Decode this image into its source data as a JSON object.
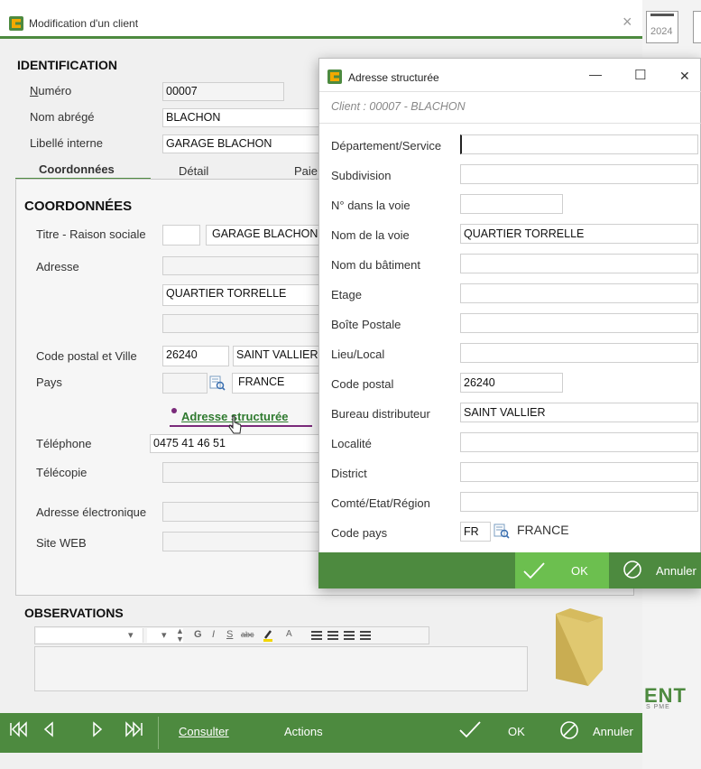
{
  "main": {
    "title": "Modification d'un client",
    "close": "×",
    "year": "2024",
    "identification": {
      "heading": "IDENTIFICATION",
      "numero_label": "Numéro",
      "numero_value": "00007",
      "nom_label": "Nom abrégé",
      "nom_value": "BLACHON",
      "libelle_label": "Libellé interne",
      "libelle_value": "GARAGE BLACHON"
    },
    "tabs": [
      "Coordonnées",
      "Détail",
      "Paie"
    ],
    "coord": {
      "heading": "COORDONNÉES",
      "titre_label": "Titre - Raison sociale",
      "raison_value": "GARAGE BLACHON",
      "adresse_label": "Adresse",
      "adresse_line2": "QUARTIER TORRELLE",
      "cp_label": "Code postal et Ville",
      "cp_value": "26240",
      "ville_value": "SAINT VALLIER",
      "pays_label": "Pays",
      "pays_value": "FRANCE",
      "adresse_link": "Adresse structurée",
      "tel_label": "Téléphone",
      "tel_value": "0475 41 46 51",
      "fax_label": "Télécopie",
      "email_label": "Adresse électronique",
      "web_label": "Site WEB"
    },
    "observations": {
      "heading": "OBSERVATIONS"
    },
    "watermark": "ENT",
    "watermark_small": "S PME",
    "bottom": {
      "consulter": "Consulter",
      "actions": "Actions",
      "ok": "OK",
      "annuler": "Annuler"
    }
  },
  "dialog": {
    "title": "Adresse structurée",
    "client_line": "Client : 00007 - BLACHON",
    "fields": [
      {
        "label": "Département/Service",
        "value": ""
      },
      {
        "label": "Subdivision",
        "value": ""
      },
      {
        "label": "N° dans la voie",
        "value": ""
      },
      {
        "label": "Nom de la voie",
        "value": "QUARTIER TORRELLE"
      },
      {
        "label": "Nom du bâtiment",
        "value": ""
      },
      {
        "label": "Etage",
        "value": ""
      },
      {
        "label": "Boîte Postale",
        "value": ""
      },
      {
        "label": "Lieu/Local",
        "value": ""
      },
      {
        "label": "Code postal",
        "value": "26240"
      },
      {
        "label": "Bureau distributeur",
        "value": "SAINT VALLIER"
      },
      {
        "label": "Localité",
        "value": ""
      },
      {
        "label": "District",
        "value": ""
      },
      {
        "label": "Comté/Etat/Région",
        "value": ""
      }
    ],
    "code_pays_label": "Code pays",
    "code_pays_value": "FR",
    "pays_name": "FRANCE",
    "ok": "OK",
    "annuler": "Annuler",
    "minimize": "—",
    "maximize": "☐",
    "close": "✕"
  },
  "colors": {
    "accent": "#4d8a3f",
    "ok_green": "#6cbf4f",
    "link_purple": "#7a2a7a"
  }
}
